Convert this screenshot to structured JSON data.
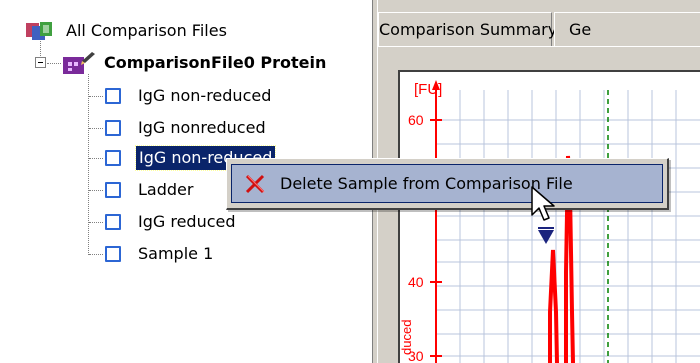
{
  "tree": {
    "root_label": "All Comparison Files",
    "root_icon": "comparison-files-icon",
    "file": {
      "label": "ComparisonFile0 Protein",
      "icon": "comparison-file-icon"
    },
    "samples": [
      {
        "label": "IgG non-reduced",
        "selected": false
      },
      {
        "label": "IgG nonreduced",
        "selected": false
      },
      {
        "label": "IgG non-reduced",
        "selected": true
      },
      {
        "label": "Ladder",
        "selected": false
      },
      {
        "label": "IgG reduced",
        "selected": false
      },
      {
        "label": "Sample 1",
        "selected": false
      }
    ]
  },
  "tabs": [
    {
      "label": "Comparison Summary",
      "active": false
    },
    {
      "label": "Ge",
      "active": false
    }
  ],
  "context_menu": {
    "items": [
      {
        "label": "Delete Sample from Comparison File",
        "icon": "delete-x-icon"
      }
    ]
  },
  "chart_data": {
    "type": "line",
    "ylabel": "[FU]",
    "y_ticks": [
      "60",
      "40",
      "30"
    ],
    "rotated_series_label_fragment": "duced",
    "marker": "triangle-down",
    "colors": {
      "axis": "#ff0000",
      "trace": "#ff0000",
      "grid": "#b8c4dc",
      "dashed_line": "#008000",
      "marker": "#1a237e"
    }
  },
  "colors": {
    "selection_bg": "#0a246a",
    "menu_highlight": "#a6b3d0",
    "checkbox_border": "#2c66d4"
  }
}
